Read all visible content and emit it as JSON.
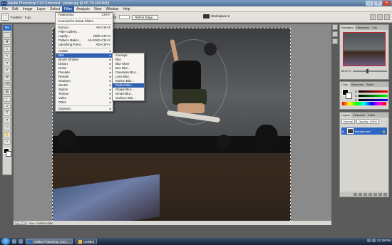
{
  "window": {
    "app_icon": "Ps",
    "title": "Adobe Photoshop CS3 Extended - [skate.jpg @ 66.7% (RGB/8)]",
    "buttons": [
      "_",
      "□",
      "✕"
    ]
  },
  "menubar": {
    "items": [
      "File",
      "Edit",
      "Image",
      "Layer",
      "Select",
      "Filter",
      "Analysis",
      "View",
      "Window",
      "Help"
    ],
    "active": "Filter"
  },
  "options": {
    "feather_label": "Feather:",
    "feather_value": "0 px",
    "width_label": "Width:",
    "height_label": "Height:",
    "refine_edge": "Refine Edge...",
    "workspace": "Workspace ▾"
  },
  "toolbox": {
    "badge": "Ps",
    "tools": [
      "⬚",
      "✥",
      "⌇",
      "✎",
      "⌗",
      "✐",
      "⚒",
      "⌫",
      "▤",
      "◐",
      "⬭",
      "T",
      "✦",
      "▭",
      "✋",
      "⌕"
    ]
  },
  "filter_menu": {
    "items": [
      {
        "label": "Radial Blur",
        "shortcut": "Ctrl+F"
      },
      {
        "sep": true
      },
      {
        "label": "Convert for Smart Filters"
      },
      {
        "sep": true
      },
      {
        "label": "Extract...",
        "shortcut": "Alt+Ctrl+X"
      },
      {
        "label": "Filter Gallery..."
      },
      {
        "label": "Liquify...",
        "shortcut": "Shift+Ctrl+X"
      },
      {
        "label": "Pattern Maker...",
        "shortcut": "Alt+Shift+Ctrl+X"
      },
      {
        "label": "Vanishing Point...",
        "shortcut": "Alt+Ctrl+V"
      },
      {
        "sep": true
      },
      {
        "label": "Artistic",
        "sub": true
      },
      {
        "label": "Blur",
        "sub": true,
        "hl": true
      },
      {
        "label": "Brush Strokes",
        "sub": true
      },
      {
        "label": "Distort",
        "sub": true
      },
      {
        "label": "Noise",
        "sub": true
      },
      {
        "label": "Pixelate",
        "sub": true
      },
      {
        "label": "Render",
        "sub": true
      },
      {
        "label": "Sharpen",
        "sub": true
      },
      {
        "label": "Sketch",
        "sub": true
      },
      {
        "label": "Stylize",
        "sub": true
      },
      {
        "label": "Texture",
        "sub": true
      },
      {
        "label": "Video",
        "sub": true
      },
      {
        "label": "Other",
        "sub": true
      },
      {
        "sep": true
      },
      {
        "label": "Digimarc",
        "sub": true
      }
    ]
  },
  "blur_menu": {
    "items": [
      {
        "label": "Average"
      },
      {
        "label": "Blur"
      },
      {
        "label": "Blur More"
      },
      {
        "label": "Box Blur..."
      },
      {
        "label": "Gaussian Blur..."
      },
      {
        "label": "Lens Blur..."
      },
      {
        "label": "Motion Blur..."
      },
      {
        "label": "Radial Blur...",
        "hl": true
      },
      {
        "label": "Shape Blur..."
      },
      {
        "label": "Smart Blur..."
      },
      {
        "label": "Surface Blur..."
      }
    ]
  },
  "status": {
    "zoom": "66.67%",
    "doc": "Doc: 3.43M/3.43M"
  },
  "navigator": {
    "tabs": [
      "Navigator",
      "Histogram",
      "Info"
    ],
    "zoom": "66.67%",
    "zoom_position": 0.4
  },
  "color_panel": {
    "tabs": [
      "Color",
      "Swatches",
      "Styles"
    ],
    "channels": [
      "R",
      "G",
      "B"
    ],
    "colors": {
      "fg": "#000000",
      "bg": "#ffffff"
    }
  },
  "layers": {
    "tabs": [
      "Layers",
      "Channels",
      "Paths"
    ],
    "blend_mode": "Normal",
    "opacity": "Opacity: 100%",
    "items": [
      {
        "name": "Background",
        "lock": "🔒"
      }
    ]
  },
  "taskbar": {
    "tasks": [
      {
        "label": "Adobe Photoshop CS3 ...",
        "icon": "photoshop-icon",
        "active": true
      },
      {
        "label": "Untitled",
        "icon": "folder-icon",
        "active": false
      }
    ],
    "time": "12:19 PM"
  }
}
